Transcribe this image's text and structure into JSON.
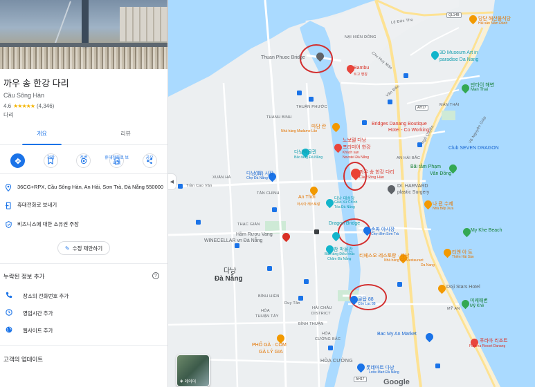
{
  "place": {
    "name": "까우 송 한강 다리",
    "local_name": "Cầu Sông Hàn",
    "rating": "4.6",
    "stars": "★★★★★",
    "reviews": "(4,346)",
    "category": "다리"
  },
  "tabs": [
    {
      "label": "개요",
      "active": true
    },
    {
      "label": "리뷰",
      "active": false
    }
  ],
  "actions": [
    {
      "label": "경로",
      "icon": "directions-icon"
    },
    {
      "label": "저장",
      "icon": "bookmark-icon"
    },
    {
      "label": "주변",
      "icon": "nearby-icon"
    },
    {
      "label": "휴대전화로 보\n내기",
      "icon": "send-to-phone-icon"
    },
    {
      "label": "공유",
      "icon": "share-icon"
    }
  ],
  "info": {
    "address": "36CG+RPX, Cầu Sông Hàn, An Hải, Sơn Trà, Đà Nẵng 550000",
    "send_to_phone": "휴대전화로 보내기",
    "claim": "비즈니스에 대한 소유권 주장",
    "suggest_edit": "수정 제안하기"
  },
  "missing": {
    "title": "누락된 정보 추가",
    "help": "?",
    "items": [
      "장소의 전화번호 추가",
      "영업시간 추가",
      "웹사이트 추가"
    ]
  },
  "updates_title": "고객의 업데이트",
  "map": {
    "city_ko": "다낭",
    "city_vi": "Đà Nẵng",
    "layer_label": "레이어",
    "google_logo": "Google",
    "labels": {
      "nai_hien_dong": "NẠI HIÊN ĐÔNG",
      "thuan_phuoc": "Thuan Phuoc Bridge",
      "bambu": "Bambu",
      "bambu_sub": "트고 행칭",
      "museum": "3D Museum Art in",
      "museum2": "paradise Da Nang",
      "dangnt": "당닫 해산물식당",
      "dangnt2": "Hải sản Năm Đảnh",
      "manthai_ko": "만타이 해변",
      "manthai": "Man Thai",
      "thanh_binh": "THANH BINH",
      "thuan_phuoc_area": "THUẬN PHƯỚC",
      "man_thai_area": "MÂN THÁI",
      "maddy": "마담 란",
      "maddy2": "Nhà hàng Madame Lân",
      "novotel": "노보텔 다낭",
      "novotel2": "프리미어 한강",
      "novotel3": "Khách sạn",
      "novotel4": "Novotel Đà Nẵng",
      "boutique": "Bridges Danang Boutique",
      "boutique2": "Hotel - Co Working",
      "seven": "Club SEVEN DRAGON",
      "museum_da": "다낭박물관",
      "museum_da2": "Bảo tàng Đà Nẵng",
      "an_hai_bac": "AN HẢI BẮC",
      "bai_tam": "Bãi tắm Phạm",
      "bai_tam2": "Văn Đồng",
      "market": "다낭(韓) 시장",
      "market2": "Chợ Đà Nẵng",
      "xuan_ha": "XUÂN HÀ",
      "tran_cao_van": "Trần Cao Vân",
      "han_bridge": "까우 송 한강 다리",
      "han_bridge2": "Cầu Sông Hàn",
      "tan_chinh": "TÂN CHÍNH",
      "harvard": "Dr. HARVARD",
      "harvard2": "plastic Surgery",
      "an_thoi": "An Thới",
      "an_thoi2": "아시아 레스토랑",
      "giao_xu": "다낭 대성당",
      "giao_xu2": "Giáo Xứ Chính",
      "giao_xu3": "Tòa Đà Nẵng",
      "na_hoa": "나 뀐 수제",
      "na_hoa2": "Nhà Bếp Xưa",
      "thac_gian": "THẠC GIÁN",
      "ham_ruou": "Hầm Rượu Vang",
      "winecellar": "WINECELLAR vn Đà Nẵng",
      "dragon": "Dragon Bridge",
      "son_tra": "손짜 야시장",
      "son_tra2": "Chợ đêm Sơn Trà",
      "my_khe": "My Khe Beach",
      "cham": "참 박물관",
      "cham2": "Bảo tàng Điêu khắc",
      "cham3": "Chăm Đà Nẵng",
      "tien_mot": "티엔 아 트",
      "tien_mot2": "Thiên Hải Sản",
      "restaurant": "티에스오 레스토랑 · 다낭",
      "restaurant2": "Nhà hàng GO Restaurant",
      "restaurant3": "Da Nang",
      "doji": "Doji Stars Hotel",
      "my_an": "미케해변",
      "my_an2": "Mỹ Khê",
      "my_an_area": "MỸ AN",
      "binh_hien": "BÌNH HIÊN",
      "hoa_thuan": "HÒA",
      "hoa_thuan2": "THUẬN TÂY",
      "hai_chau": "HẢI CHÂU",
      "district": "DISTRICT",
      "binh_thuan": "BÌNH THUẬN",
      "hoa_cuong": "HÒA",
      "hoa_cuong2": "CƯỜNG BẮC",
      "gol": "골탑 88",
      "gol2": "Côn Lạc 88",
      "duy_tan": "Duy Tân",
      "bac_my_an": "Bac My An Market",
      "furama": "푸라마 리조트",
      "furama2": "Furama Resort Danang",
      "pho_ga": "PHỐ GÀ · COM",
      "pho_ga2": "GÀ LÝ GIA",
      "hoa_cuong_area": "HÒA CƯỜNG",
      "lotte": "롯데마트 다낭",
      "lotte2": "Lotte Mart Đà Nẵng",
      "le_duc_tho": "Lê Đức Thọ",
      "van_don": "Vân Đồn",
      "ngo_quyen": "Ngô Quyền",
      "vo_nguyen_giap": "Võ Nguyên Giáp",
      "chu_huy_man": "Chu Huy Mân",
      "hwy1": "QL14B",
      "hwy2": "AH17",
      "hwy3": "AH17"
    }
  }
}
